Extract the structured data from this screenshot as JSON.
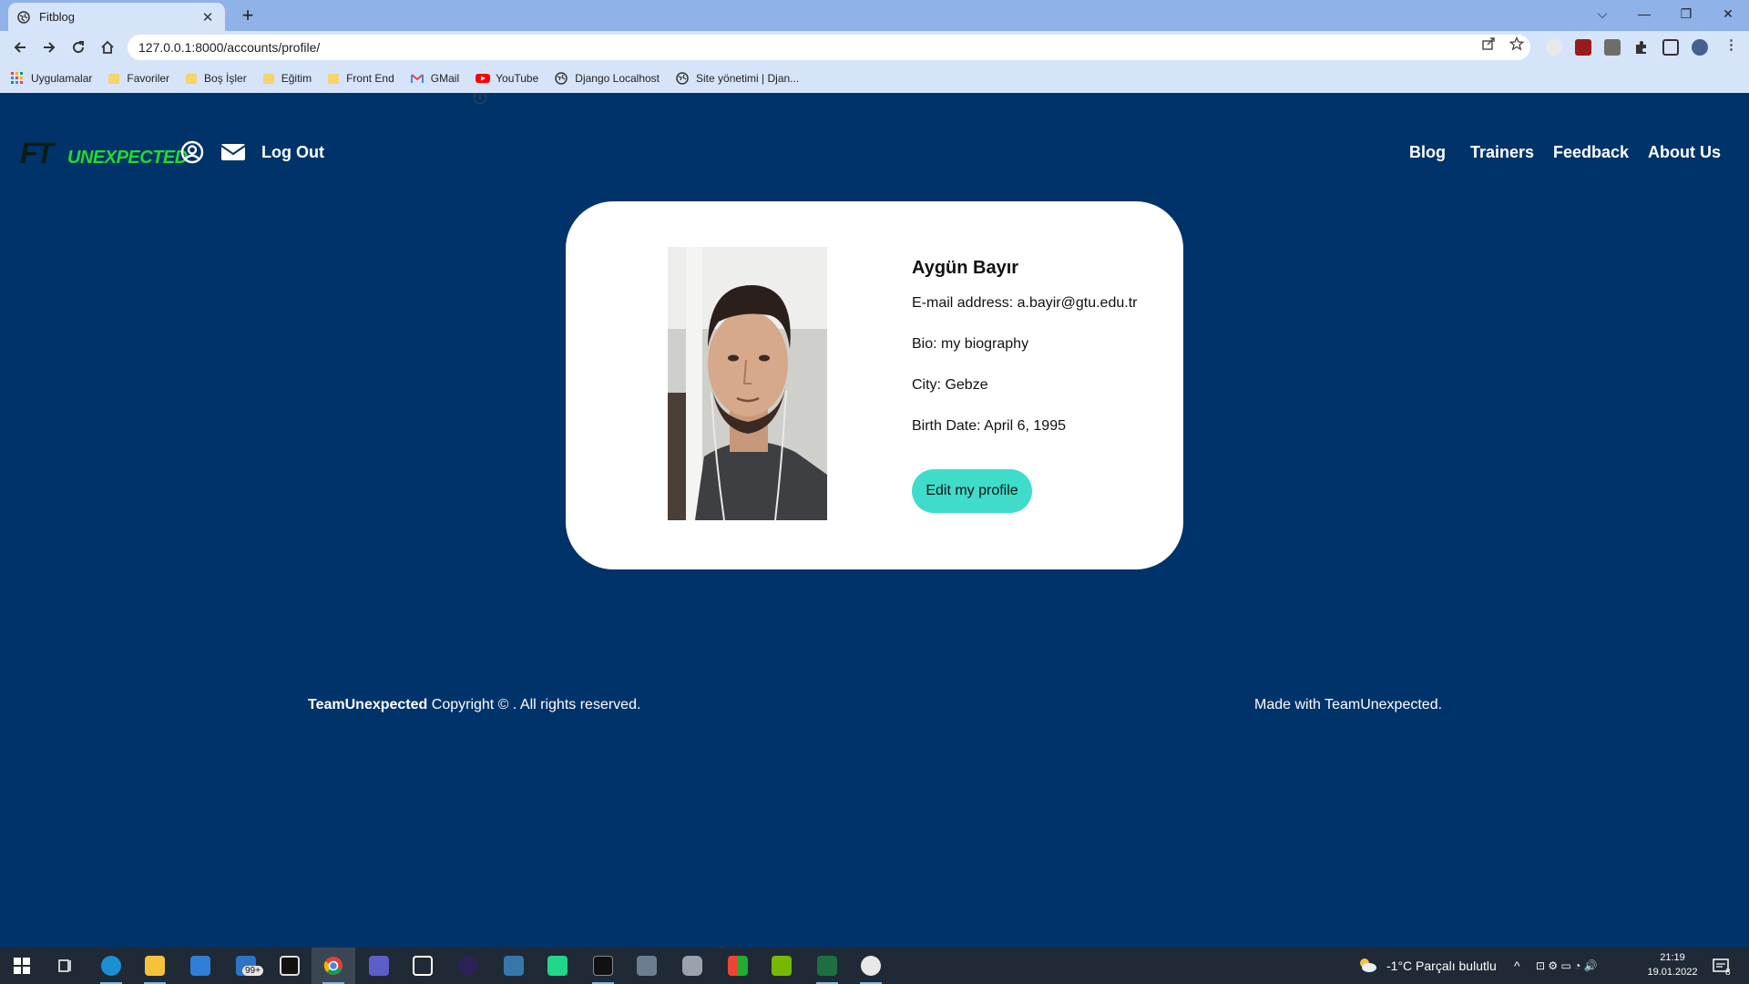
{
  "browser": {
    "tab_title": "Fitblog",
    "tab_close": "✕",
    "new_tab": "+",
    "url": "127.0.0.1:8000/accounts/profile/",
    "info_glyph": "i",
    "window_controls": [
      "⌵",
      "—",
      "❐",
      "✕"
    ]
  },
  "bookmarks": [
    {
      "label": "Uygulamalar",
      "icon": "apps-grid-icon"
    },
    {
      "label": "Favoriler",
      "icon": "folder-icon"
    },
    {
      "label": "Boş İşler",
      "icon": "folder-icon"
    },
    {
      "label": "Eğitim",
      "icon": "folder-icon"
    },
    {
      "label": "Front End",
      "icon": "folder-icon"
    },
    {
      "label": "GMail",
      "icon": "gmail-icon"
    },
    {
      "label": "YouTube",
      "icon": "youtube-icon"
    },
    {
      "label": "Django Localhost",
      "icon": "globe-icon"
    },
    {
      "label": "Site yönetimi | Djan...",
      "icon": "globe-icon"
    }
  ],
  "site": {
    "logo": {
      "part1": "FT",
      "part2": "UNEXPECTED"
    },
    "logout_label": "Log Out",
    "nav": [
      "Blog",
      "Trainers",
      "Feedback",
      "About Us"
    ]
  },
  "profile": {
    "name": "Aygün Bayır",
    "email": "E-mail address: a.bayir@gtu.edu.tr",
    "bio": "Bio: my biography",
    "city": "City: Gebze",
    "birth_date": "Birth Date: April 6, 1995",
    "edit_button": "Edit my profile"
  },
  "footer": {
    "brand": "TeamUnexpected",
    "copyright": " Copyright © . All rights reserved.",
    "made_with": "Made with TeamUnexpected."
  },
  "taskbar": {
    "weather": "-1°C  Parçalı bulutlu",
    "time": "21:19",
    "date": "19.01.2022",
    "mail_badge": "99+",
    "notif_count": "8"
  },
  "colors": {
    "page_bg": "#00336a",
    "accent_button": "#3fdccb",
    "logo_green": "#25d92c"
  }
}
